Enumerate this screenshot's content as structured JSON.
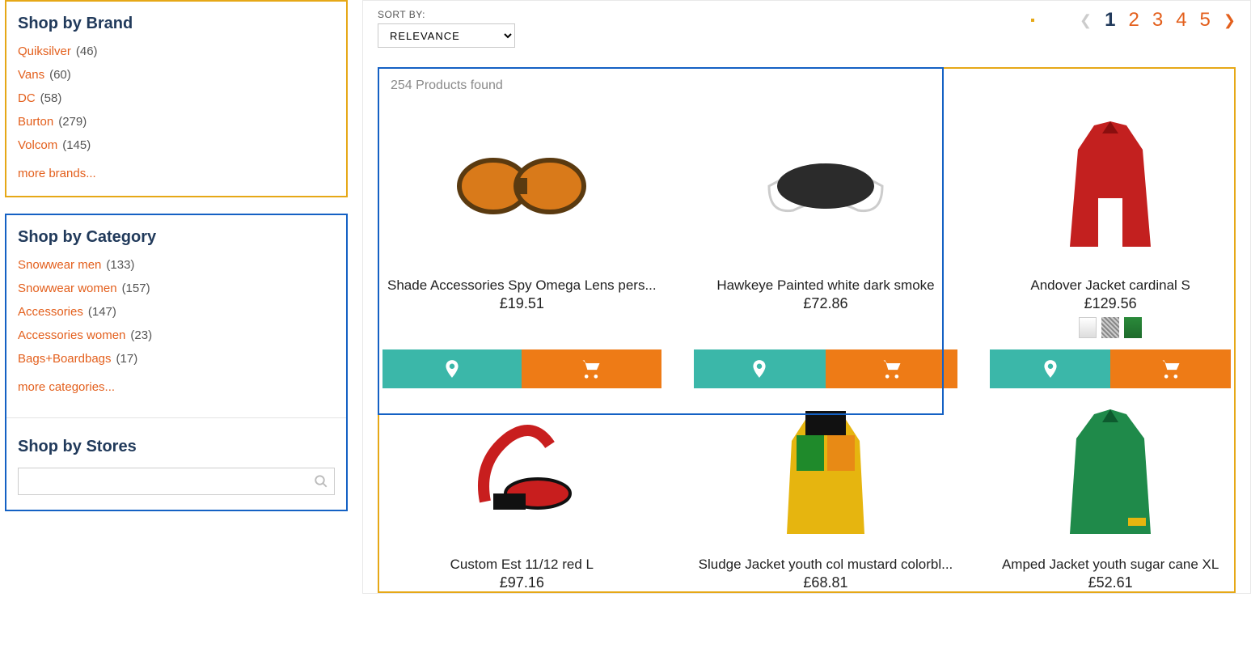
{
  "sidebar": {
    "brand": {
      "title": "Shop by Brand",
      "items": [
        {
          "label": "Quiksilver",
          "count": "(46)"
        },
        {
          "label": "Vans",
          "count": "(60)"
        },
        {
          "label": "DC",
          "count": "(58)"
        },
        {
          "label": "Burton",
          "count": "(279)"
        },
        {
          "label": "Volcom",
          "count": "(145)"
        }
      ],
      "more": "more brands..."
    },
    "category": {
      "title": "Shop by Category",
      "items": [
        {
          "label": "Snowwear men",
          "count": "(133)"
        },
        {
          "label": "Snowwear women",
          "count": "(157)"
        },
        {
          "label": "Accessories",
          "count": "(147)"
        },
        {
          "label": "Accessories women",
          "count": "(23)"
        },
        {
          "label": "Bags+Boardbags",
          "count": "(17)"
        }
      ],
      "more": "more categories..."
    },
    "stores": {
      "title": "Shop by Stores",
      "placeholder": ""
    }
  },
  "sort": {
    "label": "SORT BY:",
    "selected": "RELEVANCE"
  },
  "pagination": {
    "pages": [
      "1",
      "2",
      "3",
      "4",
      "5"
    ],
    "current": "1"
  },
  "results": {
    "found_text": "254 Products found",
    "products": [
      {
        "name": "Shade Accessories Spy Omega Lens pers...",
        "price": "£19.51",
        "variants": false
      },
      {
        "name": "Hawkeye Painted white dark smoke",
        "price": "£72.86",
        "variants": false
      },
      {
        "name": "Andover Jacket cardinal S",
        "price": "£129.56",
        "variants": true
      },
      {
        "name": "Custom Est 11/12 red L",
        "price": "£97.16",
        "variants": false
      },
      {
        "name": "Sludge Jacket youth col mustard colorbl...",
        "price": "£68.81",
        "variants": false
      },
      {
        "name": "Amped Jacket youth sugar cane XL",
        "price": "£52.61",
        "variants": false
      }
    ]
  }
}
